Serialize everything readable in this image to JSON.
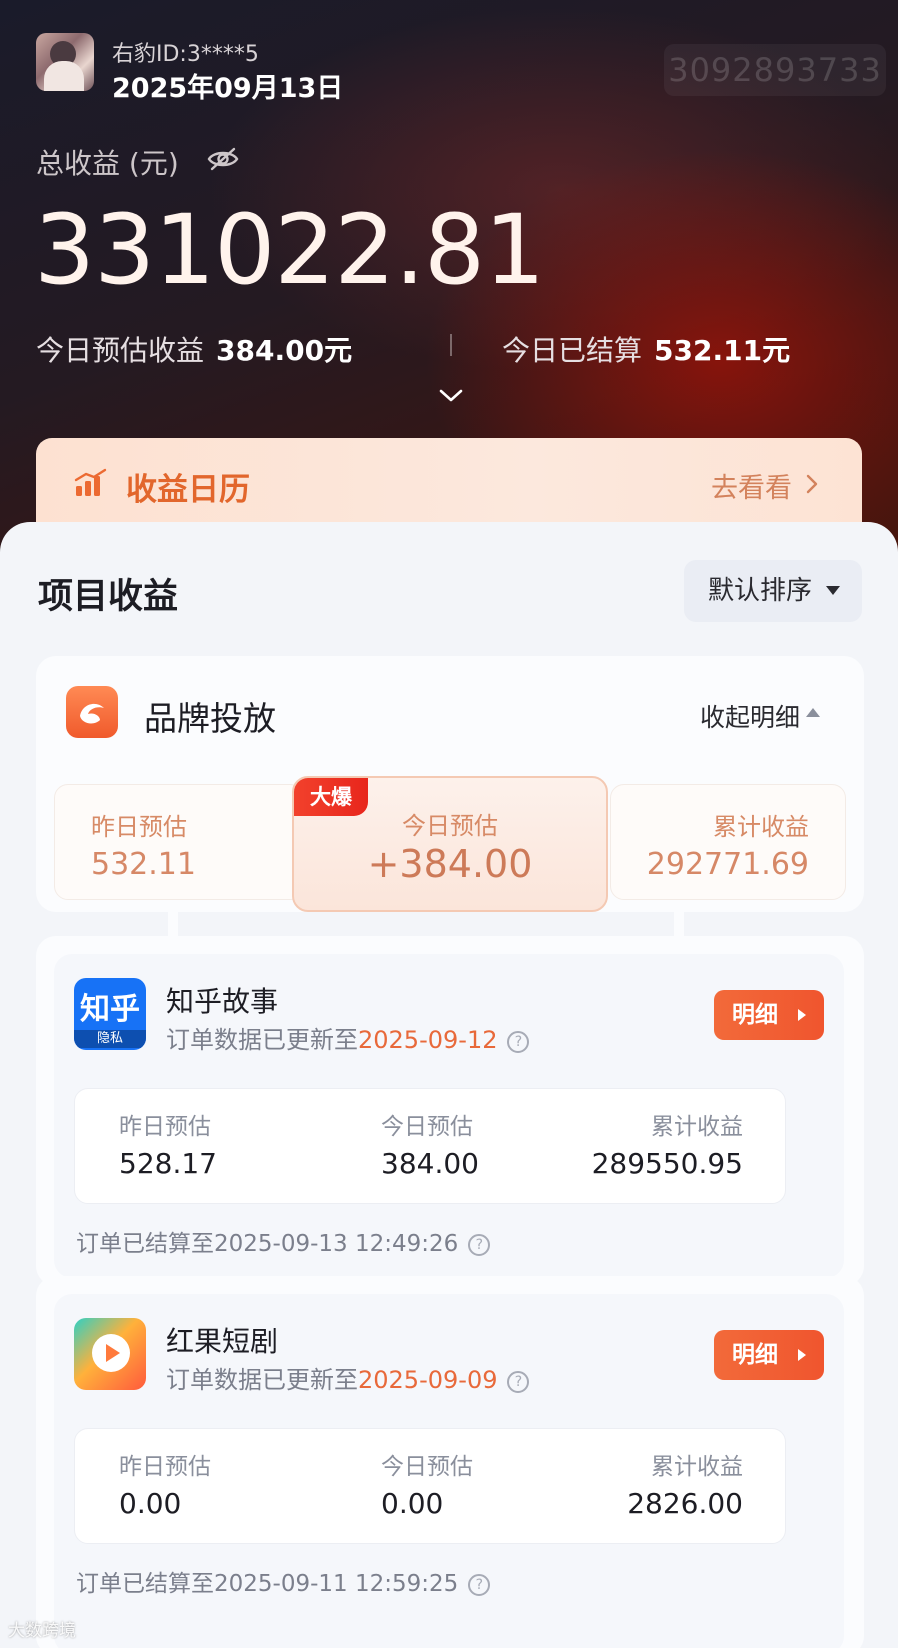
{
  "header": {
    "user_id": "右豹ID:3****5",
    "date": "2025年09月13日",
    "faded_number": "3092893733",
    "total_label": "总收益 (元)",
    "total_value": "331022.81",
    "today_estimate_label": "今日预估收益",
    "today_estimate_value": "384.00元",
    "today_settled_label": "今日已结算",
    "today_settled_value": "532.11元"
  },
  "calendar": {
    "title": "收益日历",
    "go_label": "去看看"
  },
  "projects_section": {
    "title": "项目收益",
    "sort_label": "默认排序"
  },
  "brand": {
    "name": "品牌投放",
    "collapse_label": "收起明细",
    "hot_badge": "大爆",
    "yesterday_label": "昨日预估",
    "yesterday_value": "532.11",
    "today_label": "今日预估",
    "today_value": "+384.00",
    "total_label": "累计收益",
    "total_value": "292771.69"
  },
  "projects": [
    {
      "name": "知乎故事",
      "icon_text": "知乎",
      "icon_sub": "隐私",
      "updated_prefix": "订单数据已更新至",
      "updated_date": "2025-09-12",
      "detail_label": "明细",
      "yesterday_label": "昨日预估",
      "yesterday_value": "528.17",
      "today_label": "今日预估",
      "today_value": "384.00",
      "total_label": "累计收益",
      "total_value": "289550.95",
      "settled_text": "订单已结算至2025-09-13 12:49:26"
    },
    {
      "name": "红果短剧",
      "updated_prefix": "订单数据已更新至",
      "updated_date": "2025-09-09",
      "detail_label": "明细",
      "yesterday_label": "昨日预估",
      "yesterday_value": "0.00",
      "today_label": "今日预估",
      "today_value": "0.00",
      "total_label": "累计收益",
      "total_value": "2826.00",
      "settled_text": "订单已结算至2025-09-11 12:59:25"
    }
  ],
  "watermark": "大数跨境",
  "icons": {
    "eye": "eye-off-icon",
    "expand": "chevron-down-icon",
    "calendar": "bar-chart-icon",
    "go": "chevron-right-icon",
    "sort": "caret-down-icon",
    "collapse": "caret-up-icon",
    "help": "question-circle-icon",
    "detail": "play-triangle-icon"
  },
  "colors": {
    "accent": "#f0552e",
    "accent_text": "#e8693a",
    "hot_badge": "#e8261c"
  }
}
